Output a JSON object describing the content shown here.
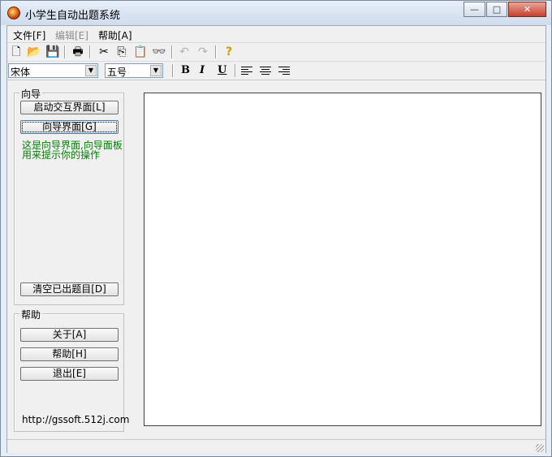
{
  "window": {
    "title": "小学生自动出题系统"
  },
  "window_controls": {
    "minimize": "—",
    "maximize": "□",
    "close": "✕"
  },
  "menu": {
    "file": "文件[F]",
    "edit": "编辑[E]",
    "help": "帮助[A]"
  },
  "toolbar": {
    "icons": [
      "new-file-icon",
      "open-folder-icon",
      "save-icon",
      "print-icon",
      "cut-icon",
      "copy-icon",
      "paste-icon",
      "find-icon",
      "undo-icon",
      "redo-icon",
      "help-icon"
    ],
    "glyphs": {
      "new": "🗋",
      "open": "📂",
      "save": "💾",
      "print": "🖶",
      "cut": "✂",
      "copy": "⎘",
      "paste": "📋",
      "find": "👓",
      "undo": "↶",
      "redo": "↷",
      "help": "?"
    }
  },
  "format": {
    "font_value": "宋体",
    "size_value": "五号",
    "bold": "B",
    "italic": "I",
    "underline": "U"
  },
  "wizard_group": {
    "legend": "向导",
    "start_button": "启动交互界面[L]",
    "wizard_button": "向导界面[G]",
    "hint": "这是向导界面,向导面板用来提示你的操作",
    "hint_color": "#008000",
    "clear_button": "清空已出题目[D]"
  },
  "help_group": {
    "legend": "帮助",
    "about_button": "关于[A]",
    "help_button": "帮助[H]",
    "exit_button": "退出[E]"
  },
  "footer_link": "http://gssoft.512j.com",
  "editor": {
    "content": ""
  }
}
